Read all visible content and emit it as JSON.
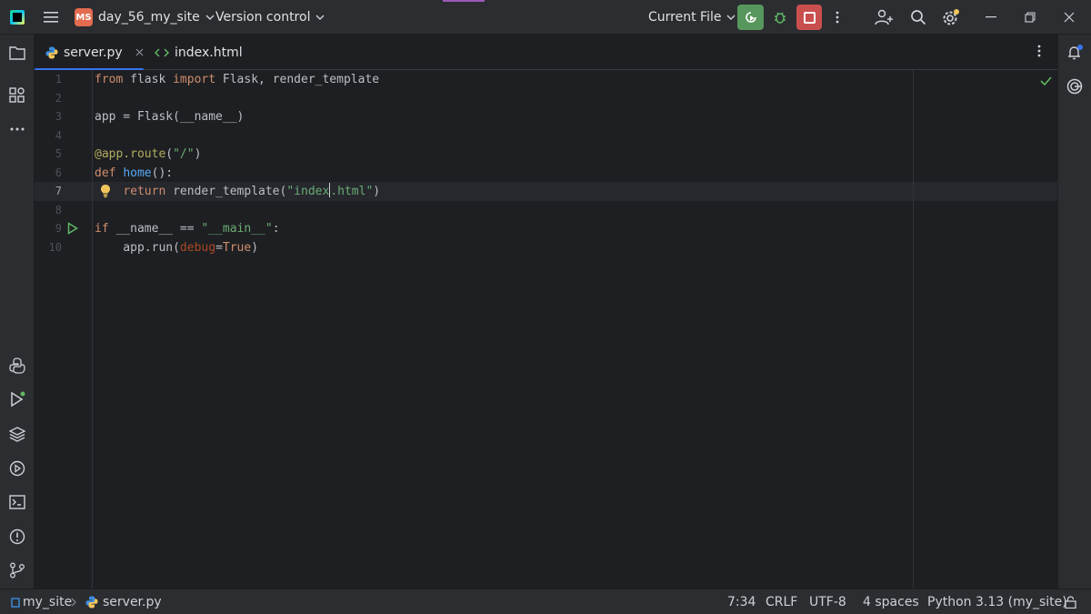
{
  "titlebar": {
    "project_badge": "MS",
    "project_name": "day_56_my_site",
    "version_control": "Version control",
    "run_config": "Current File",
    "icons": [
      "app-logo-icon",
      "menu-icon",
      "chevron-down-icon",
      "run-icon",
      "debug-icon",
      "stop-icon",
      "more-vertical-icon",
      "add-user-icon",
      "search-icon",
      "gear-icon",
      "minimize-icon",
      "restore-icon",
      "close-icon"
    ]
  },
  "tabs": [
    {
      "label": "server.py",
      "active": true,
      "close": "×"
    },
    {
      "label": "index.html",
      "active": false
    }
  ],
  "editor": {
    "lines": [
      {
        "n": "1"
      },
      {
        "n": "2"
      },
      {
        "n": "3"
      },
      {
        "n": "4"
      },
      {
        "n": "5"
      },
      {
        "n": "6"
      },
      {
        "n": "7"
      },
      {
        "n": "8"
      },
      {
        "n": "9"
      },
      {
        "n": "10"
      }
    ],
    "tokens": {
      "l1": [
        "from",
        " flask ",
        "import",
        " Flask, render_template"
      ],
      "l3": [
        "app = Flask(__name__)"
      ],
      "l5": [
        "@app.route",
        "(",
        "\"/\"",
        ")"
      ],
      "l6": [
        "def",
        " ",
        "home",
        "():"
      ],
      "l7": [
        "    ",
        "return",
        " render_template(",
        "\"index",
        ".html\"",
        ")"
      ],
      "l9": [
        "if",
        " __name__ == ",
        "\"__main__\"",
        ":"
      ],
      "l10": [
        "    app.run(",
        "debug",
        "=",
        "True",
        ")"
      ]
    }
  },
  "statusbar": {
    "breadcrumb_project": "my_site",
    "breadcrumb_file": "server.py",
    "position": "7:34",
    "line_ending": "CRLF",
    "encoding": "UTF-8",
    "indent": "4 spaces",
    "interpreter": "Python 3.13 (my_site)"
  },
  "colors": {
    "accent": "#3574f0",
    "run": "#57965c",
    "stop": "#c94f4f",
    "keyword": "#cf8e6d",
    "string": "#6aab73",
    "function": "#56a8f5"
  }
}
